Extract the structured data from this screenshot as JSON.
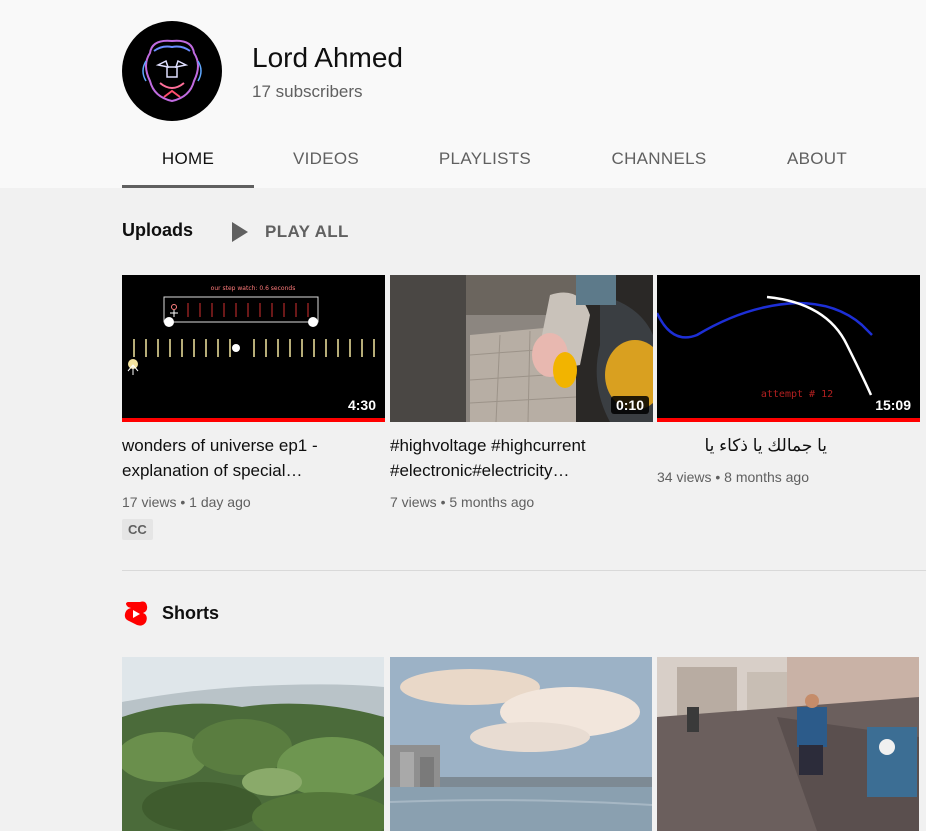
{
  "channel": {
    "name": "Lord Ahmed",
    "subscribers": "17 subscribers"
  },
  "tabs": [
    {
      "label": "HOME",
      "active": true
    },
    {
      "label": "VIDEOS",
      "active": false
    },
    {
      "label": "PLAYLISTS",
      "active": false
    },
    {
      "label": "CHANNELS",
      "active": false
    },
    {
      "label": "ABOUT",
      "active": false
    }
  ],
  "uploads": {
    "title": "Uploads",
    "play_all": "PLAY ALL",
    "videos": [
      {
        "title": "wonders of universe ep1 - explanation of special…",
        "duration": "4:30",
        "views": "17 views",
        "age": "1 day ago",
        "badge": "CC",
        "thumb_text": "our step watch: 0.6 seconds",
        "watched_fraction": 1.0
      },
      {
        "title": "#highvoltage #highcurrent #electronic#electricity…",
        "duration": "0:10",
        "views": "7 views",
        "age": "5 months ago",
        "watched_fraction": 0
      },
      {
        "title": "يا جمالك يا ذكاء يا اصطناعي",
        "duration": "15:09",
        "views": "34 views",
        "age": "8 months ago",
        "thumb_text": "attempt # 12",
        "watched_fraction": 1.0
      }
    ]
  },
  "shorts": {
    "title": "Shorts"
  },
  "colors": {
    "accent": "#ff0000",
    "tab_underline": "#606060",
    "text_secondary": "#606060"
  },
  "icons": [
    "play-icon",
    "shorts-logo-icon"
  ]
}
